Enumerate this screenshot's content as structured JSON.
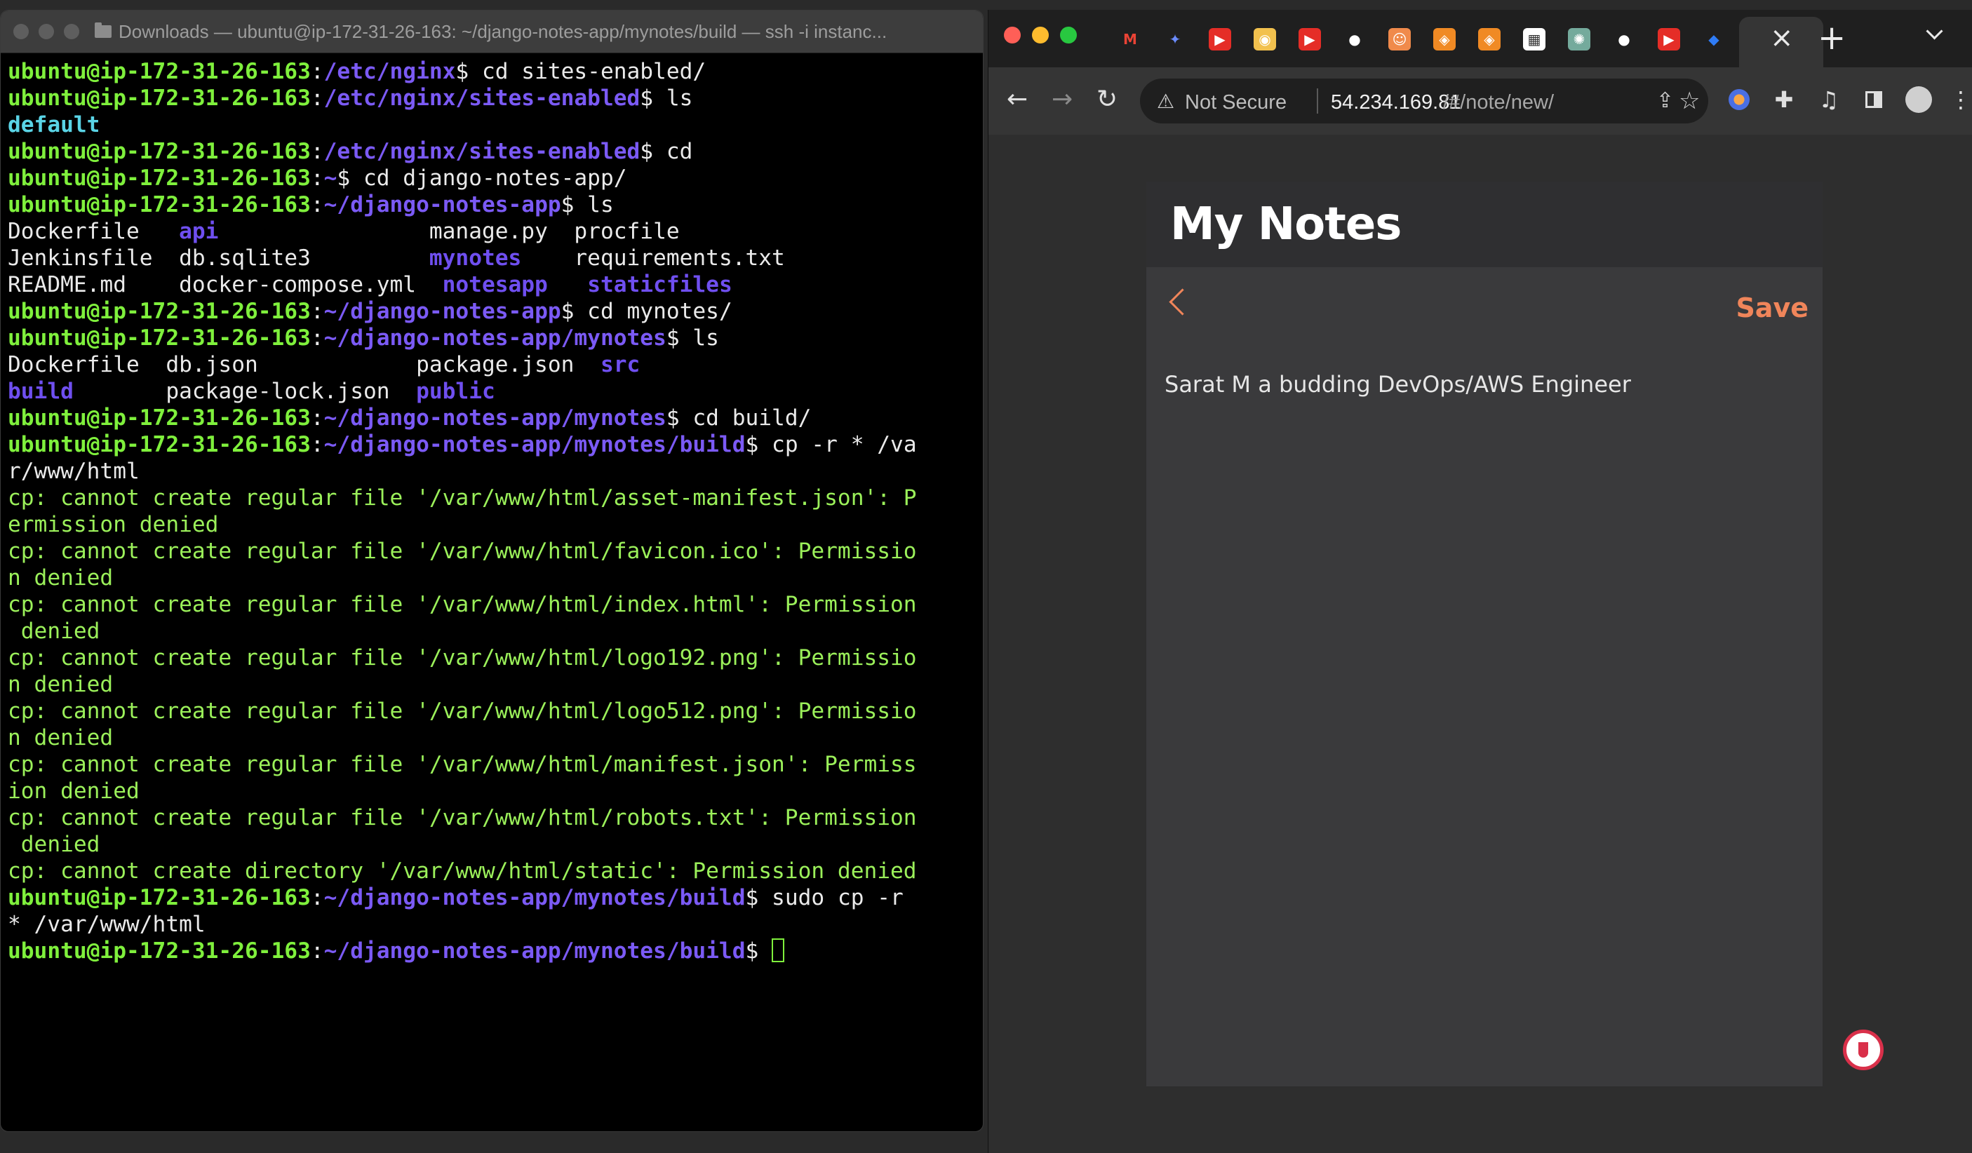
{
  "terminal": {
    "title": "Downloads — ubuntu@ip-172-31-26-163: ~/django-notes-app/mynotes/build — ssh -i instanc...",
    "lines": [
      {
        "type": "prompt",
        "host": "ubuntu@ip-172-31-26-163",
        "path": "/etc/nginx",
        "cmd": " cd sites-enabled/"
      },
      {
        "type": "prompt",
        "host": "ubuntu@ip-172-31-26-163",
        "path": "/etc/nginx/sites-enabled",
        "cmd": " ls"
      },
      {
        "type": "ls",
        "cells": [
          {
            "t": "default",
            "c": "dir-def"
          }
        ]
      },
      {
        "type": "prompt",
        "host": "ubuntu@ip-172-31-26-163",
        "path": "/etc/nginx/sites-enabled",
        "cmd": " cd"
      },
      {
        "type": "prompt",
        "host": "ubuntu@ip-172-31-26-163",
        "path": "~",
        "cmd": " cd django-notes-app/"
      },
      {
        "type": "prompt",
        "host": "ubuntu@ip-172-31-26-163",
        "path": "~/django-notes-app",
        "cmd": " ls"
      },
      {
        "type": "ls",
        "cells": [
          {
            "t": "Dockerfile   ",
            "c": "ls-file"
          },
          {
            "t": "api",
            "c": "ls-dir"
          },
          {
            "t": "                manage.py  procfile",
            "c": "ls-file"
          }
        ]
      },
      {
        "type": "ls",
        "cells": [
          {
            "t": "Jenkinsfile  db.sqlite3         ",
            "c": "ls-file"
          },
          {
            "t": "mynotes",
            "c": "ls-dir"
          },
          {
            "t": "    requirements.txt",
            "c": "ls-file"
          }
        ]
      },
      {
        "type": "ls",
        "cells": [
          {
            "t": "README.md    docker-compose.yml  ",
            "c": "ls-file"
          },
          {
            "t": "notesapp",
            "c": "ls-dir"
          },
          {
            "t": "   ",
            "c": "ls-file"
          },
          {
            "t": "staticfiles",
            "c": "ls-dir"
          }
        ]
      },
      {
        "type": "prompt",
        "host": "ubuntu@ip-172-31-26-163",
        "path": "~/django-notes-app",
        "cmd": " cd mynotes/"
      },
      {
        "type": "prompt",
        "host": "ubuntu@ip-172-31-26-163",
        "path": "~/django-notes-app/mynotes",
        "cmd": " ls"
      },
      {
        "type": "ls",
        "cells": [
          {
            "t": "Dockerfile  db.json            package.json  ",
            "c": "ls-file"
          },
          {
            "t": "src",
            "c": "ls-dir"
          }
        ]
      },
      {
        "type": "ls",
        "cells": [
          {
            "t": "build",
            "c": "ls-dir"
          },
          {
            "t": "       package-lock.json  ",
            "c": "ls-file"
          },
          {
            "t": "public",
            "c": "ls-dir"
          }
        ]
      },
      {
        "type": "prompt",
        "host": "ubuntu@ip-172-31-26-163",
        "path": "~/django-notes-app/mynotes",
        "cmd": " cd build/"
      },
      {
        "type": "prompt",
        "host": "ubuntu@ip-172-31-26-163",
        "path": "~/django-notes-app/mynotes/build",
        "cmd": " cp -r * /va"
      },
      {
        "type": "plain",
        "text": "r/www/html",
        "c": "cmd"
      },
      {
        "type": "plain",
        "text": "cp: cannot create regular file '/var/www/html/asset-manifest.json': P",
        "c": "err"
      },
      {
        "type": "plain",
        "text": "ermission denied",
        "c": "err"
      },
      {
        "type": "plain",
        "text": "cp: cannot create regular file '/var/www/html/favicon.ico': Permissio",
        "c": "err"
      },
      {
        "type": "plain",
        "text": "n denied",
        "c": "err"
      },
      {
        "type": "plain",
        "text": "cp: cannot create regular file '/var/www/html/index.html': Permission",
        "c": "err"
      },
      {
        "type": "plain",
        "text": " denied",
        "c": "err"
      },
      {
        "type": "plain",
        "text": "cp: cannot create regular file '/var/www/html/logo192.png': Permissio",
        "c": "err"
      },
      {
        "type": "plain",
        "text": "n denied",
        "c": "err"
      },
      {
        "type": "plain",
        "text": "cp: cannot create regular file '/var/www/html/logo512.png': Permissio",
        "c": "err"
      },
      {
        "type": "plain",
        "text": "n denied",
        "c": "err"
      },
      {
        "type": "plain",
        "text": "cp: cannot create regular file '/var/www/html/manifest.json': Permiss",
        "c": "err"
      },
      {
        "type": "plain",
        "text": "ion denied",
        "c": "err"
      },
      {
        "type": "plain",
        "text": "cp: cannot create regular file '/var/www/html/robots.txt': Permission",
        "c": "err"
      },
      {
        "type": "plain",
        "text": " denied",
        "c": "err"
      },
      {
        "type": "plain",
        "text": "cp: cannot create directory '/var/www/html/static': Permission denied",
        "c": "err"
      },
      {
        "type": "prompt",
        "host": "ubuntu@ip-172-31-26-163",
        "path": "~/django-notes-app/mynotes/build",
        "cmd": " sudo cp -r"
      },
      {
        "type": "plain",
        "text": "* /var/www/html",
        "c": "cmd"
      },
      {
        "type": "prompt",
        "host": "ubuntu@ip-172-31-26-163",
        "path": "~/django-notes-app/mynotes/build",
        "cmd": " ",
        "cursor": true
      }
    ]
  },
  "browser": {
    "tab_icons": [
      {
        "name": "gmail-icon",
        "glyph": "M",
        "bg": "transparent",
        "fg": "#ea4335"
      },
      {
        "name": "sparkle-icon",
        "glyph": "✦",
        "bg": "transparent",
        "fg": "#6b8cff"
      },
      {
        "name": "youtube-icon",
        "glyph": "▶",
        "bg": "#e52d27",
        "fg": "#ffffff"
      },
      {
        "name": "app-icon",
        "glyph": "◉",
        "bg": "#f2c14e",
        "fg": "#ffffff"
      },
      {
        "name": "youtube-icon",
        "glyph": "▶",
        "bg": "#e52d27",
        "fg": "#ffffff"
      },
      {
        "name": "github-icon",
        "glyph": "●",
        "bg": "transparent",
        "fg": "#ffffff"
      },
      {
        "name": "avatar-icon",
        "glyph": "☺",
        "bg": "#f08a4b",
        "fg": "#ffffff"
      },
      {
        "name": "aws-icon",
        "glyph": "◈",
        "bg": "#f08a24",
        "fg": "#ffffff"
      },
      {
        "name": "aws-icon",
        "glyph": "◈",
        "bg": "#f08a24",
        "fg": "#ffffff"
      },
      {
        "name": "icons-icon",
        "glyph": "▦",
        "bg": "#ffffff",
        "fg": "#333333"
      },
      {
        "name": "chatgpt-icon",
        "glyph": "✺",
        "bg": "#74aa9c",
        "fg": "#ffffff"
      },
      {
        "name": "github-icon",
        "glyph": "●",
        "bg": "transparent",
        "fg": "#ffffff"
      },
      {
        "name": "youtube-icon",
        "glyph": "▶",
        "bg": "#e52d27",
        "fg": "#ffffff"
      },
      {
        "name": "jira-icon",
        "glyph": "◆",
        "bg": "transparent",
        "fg": "#2f7cf6"
      }
    ],
    "not_secure_label": "Not Secure",
    "url_host": "54.234.169.81",
    "url_path": "/#/note/new/",
    "colors": {
      "accent": "#f0855a",
      "card": "#3a3a3c",
      "header": "#2f2f31"
    }
  },
  "notes_app": {
    "title": "My Notes",
    "save_label": "Save",
    "note_body": "Sarat M a budding DevOps/AWS Engineer"
  }
}
